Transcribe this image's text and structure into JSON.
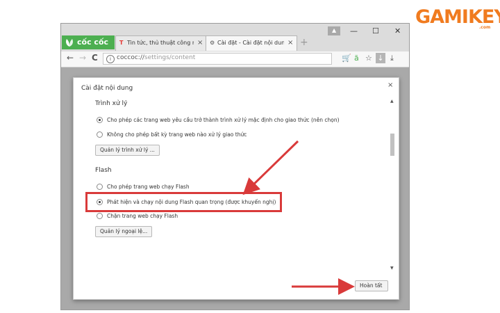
{
  "watermark": {
    "logo_text": "GAMIKEY",
    "suffix": ".com"
  },
  "browser": {
    "brand_label": "cốc cốc",
    "tabs": [
      {
        "icon": "T",
        "title": "Tin tức, thủ thuật công n",
        "close": "×"
      },
      {
        "icon": "⚙",
        "title": "Cài đặt - Cài đặt nội dung",
        "close": "×"
      }
    ],
    "new_tab": "+",
    "window_controls": {
      "minimize": "—",
      "maximize": "☐",
      "close": "✕"
    },
    "nav": {
      "back": "←",
      "forward": "→",
      "reload": "C"
    },
    "address": {
      "scheme": "coccoc://",
      "path": "settings/content"
    }
  },
  "dialog": {
    "title": "Cài đặt nội dung",
    "close": "×",
    "sections": {
      "handlers": {
        "heading": "Trình xử lý",
        "options": [
          {
            "label": "Cho phép các trang web yêu cầu trở thành trình xử lý mặc định cho giao thức (nên chọn)",
            "selected": true
          },
          {
            "label": "Không cho phép bất kỳ trang web nào xử lý giao thức",
            "selected": false
          }
        ],
        "manage_button": "Quản lý trình xử lý ..."
      },
      "flash": {
        "heading": "Flash",
        "options": [
          {
            "label": "Cho phép trang web chạy Flash",
            "selected": false
          },
          {
            "label": "Phát hiện và chạy nội dung Flash quan trọng (được khuyến nghị)",
            "selected": true
          },
          {
            "label": "Chặn trang web chạy Flash",
            "selected": false
          }
        ],
        "manage_button": "Quản lý ngoại lệ..."
      }
    },
    "done_button": "Hoàn tất"
  },
  "colors": {
    "accent_red": "#d93a3a",
    "brand_green": "#4caf50",
    "logo_orange": "#f07b1f"
  }
}
